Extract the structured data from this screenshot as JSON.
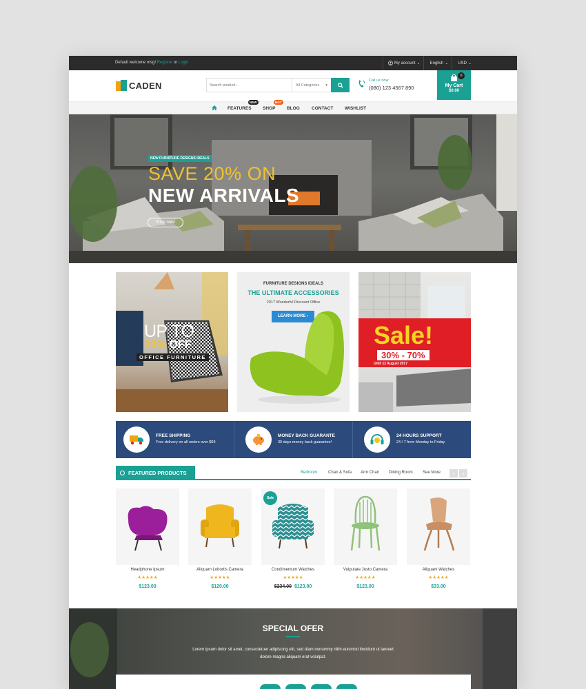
{
  "topbar": {
    "welcome": "Default welcome msg!",
    "register": "Register",
    "or": "or",
    "login": "Login",
    "account": "My account",
    "language": "English",
    "currency": "USD"
  },
  "header": {
    "logo": "CADEN",
    "search_placeholder": "Search product...",
    "category": "All Categories",
    "call_label": "Call us now",
    "phone": "(080) 123 4567 890",
    "cart_label": "My Cart",
    "cart_amount": "$0.00",
    "cart_count": "0"
  },
  "nav": {
    "items": [
      "FEATURES",
      "SHOP",
      "BLOG",
      "CONTACT",
      "WISHLIST"
    ],
    "tag_new": "NEW",
    "tag_hot": "HOT"
  },
  "hero": {
    "label": "NEW FURNITURE DESIGNS IDEALS",
    "line1": "SAVE 20% ON",
    "line2": "NEW ARRIVALS",
    "button": "Shop now!"
  },
  "banners": {
    "b1": {
      "up": "UP TO",
      "pct": "20%",
      "off": "OFF",
      "sub": "OFFICE FURNITURE"
    },
    "b2": {
      "kicker": "FURNITURE DESIGNS IDEALS",
      "title": "THE ULTIMATE ACCESSORIES",
      "sub": "2017 Wonderful Discount Office",
      "button": "LEARN MORE"
    },
    "b3": {
      "sale": "Sale!",
      "pct": "30% - 70%",
      "until": "Until 12 August 2017"
    }
  },
  "services": [
    {
      "icon": "truck-icon",
      "title": "FREE SHIPPING",
      "desc": "Free delivery on all orders over $99"
    },
    {
      "icon": "piggy-bank-icon",
      "title": "MONEY BACK GUARANTE",
      "desc": "30 days money back guarantee!"
    },
    {
      "icon": "headset-icon",
      "title": "24 HOURS SUPPORT",
      "desc": "24 / 7 from Monday to Friday"
    }
  ],
  "featured": {
    "title": "FEATURED PRODUCTS",
    "tabs": [
      "Bedroom",
      "Chair & Sofa",
      "Arm Chair",
      "Dining Room",
      "See More"
    ],
    "products": [
      {
        "name": "Headphone Ipsum",
        "old_price": "",
        "price": "$123.00",
        "sale": "",
        "color": "#9b1f9a"
      },
      {
        "name": "Aliquam Lobortis Camera",
        "old_price": "",
        "price": "$120.00",
        "sale": "",
        "color": "#f0b61e"
      },
      {
        "name": "Condimentum Watches",
        "old_price": "$234.00",
        "price": "$123.00",
        "sale": "Sale",
        "color": "#2e8f92"
      },
      {
        "name": "Vulputate Justo Camera",
        "old_price": "",
        "price": "$123.00",
        "sale": "",
        "color": "#8fc27a"
      },
      {
        "name": "Aliquam Watches",
        "old_price": "",
        "price": "$33.00",
        "sale": "",
        "color": "#d9a57c"
      }
    ],
    "stars": "★★★★★"
  },
  "special": {
    "title": "SPECIAL OFER",
    "desc1": "Lorem ipsum dolor sit amet, consectetuer adipiscing elit, sed diam nonummy nibh euismod tincidunt ut laoreet",
    "desc2": "dolore magna aliquam erat volutpat."
  },
  "colors": {
    "accent": "#1aa194",
    "navy": "#2c4a7c",
    "sale_red": "#e01e26",
    "gold": "#f0c230"
  }
}
